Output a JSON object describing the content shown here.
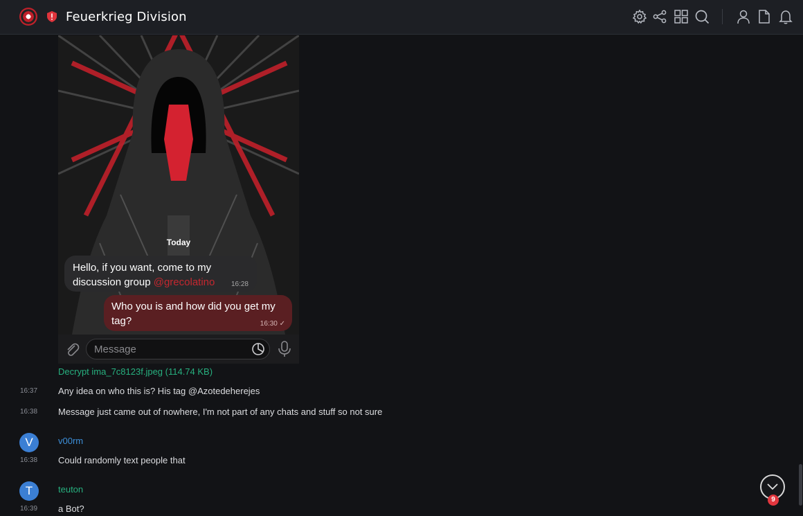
{
  "header": {
    "title": "Feuerkrieg Division",
    "icons": [
      "settings-icon",
      "share-icon",
      "grid-icon",
      "search-icon",
      "user-icon",
      "document-icon",
      "bell-icon"
    ]
  },
  "media": {
    "date_separator": "Today",
    "incoming": {
      "text": "Hello, if you want, come to my discussion group ",
      "mention": "@grecolatino",
      "time": "16:28"
    },
    "outgoing": {
      "text": "Who you is and how did you get my tag?",
      "time": "16:30"
    },
    "composer_placeholder": "Message",
    "caption_link": "Decrypt ima_7c8123f.jpeg (114.74 KB)"
  },
  "messages": [
    {
      "time": "16:37",
      "text": "Any idea on who this is? His tag @Azotedeherejes"
    },
    {
      "time": "16:38",
      "text": "Message just came out of nowhere, I'm not part of any chats and stuff so not sure"
    }
  ],
  "groups": [
    {
      "initial": "V",
      "name": "v00rm",
      "name_color": "#3d8fd9",
      "time": "16:38",
      "text": "Could randomly text people that"
    },
    {
      "initial": "T",
      "name": "teuton",
      "name_color": "#27b07f",
      "time": "16:39",
      "text": "a Bot?"
    }
  ],
  "scroll_down": {
    "unread_count": "9"
  },
  "colors": {
    "accent_red": "#c4272f",
    "link_green": "#27b07f",
    "avatar_blue": "#3b7fd4"
  }
}
